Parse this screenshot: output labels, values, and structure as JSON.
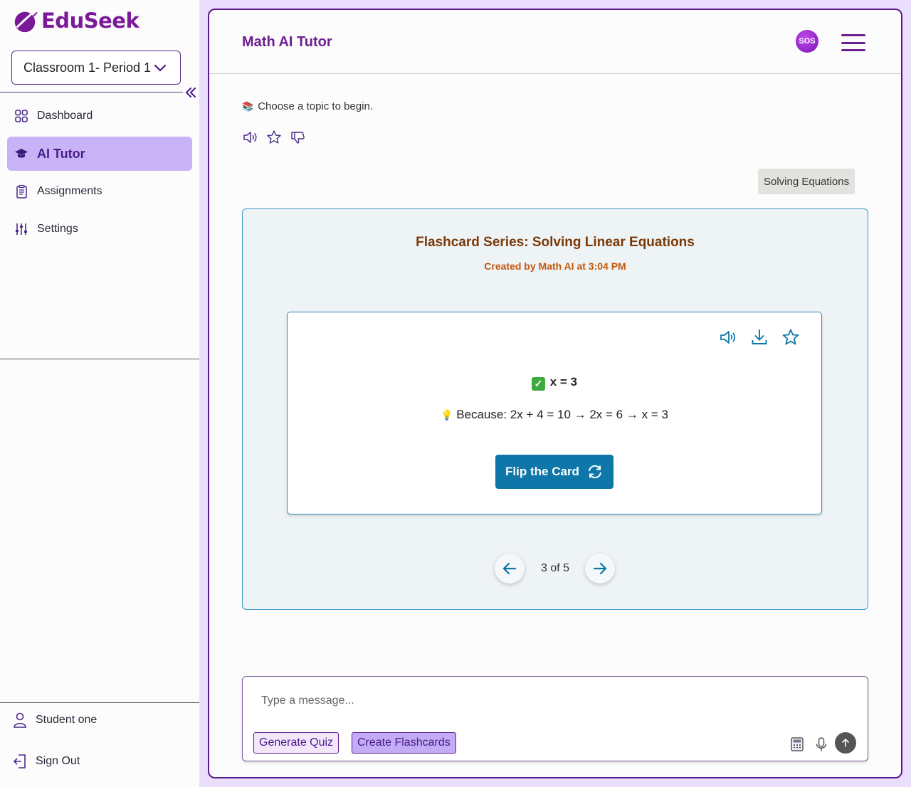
{
  "app": {
    "name": "EduSeek"
  },
  "sidebar": {
    "classroom_select": "Classroom 1- Period 1",
    "nav": [
      {
        "label": "Dashboard",
        "icon": "grid-icon"
      },
      {
        "label": "AI Tutor",
        "icon": "graduation-cap-icon",
        "active": true
      },
      {
        "label": "Assignments",
        "icon": "clipboard-icon"
      },
      {
        "label": "Settings",
        "icon": "sliders-icon"
      }
    ],
    "user_label": "Student one",
    "signout_label": "Sign Out"
  },
  "header": {
    "title": "Math AI Tutor",
    "sos_label": "SOS"
  },
  "chat": {
    "bot_message": "Choose a topic to begin.",
    "user_message": "Solving Equations"
  },
  "flashcards": {
    "title": "Flashcard Series: Solving Linear Equations",
    "subtitle": "Created by Math AI at 3:04 PM",
    "answer": "x = 3",
    "reason": "Because: 2x + 4 = 10 → 2x = 6 → x = 3",
    "flip_label": "Flip the Card",
    "page_indicator": "3 of 5",
    "current_page": 3,
    "total_pages": 5
  },
  "composer": {
    "placeholder": "Type a message...",
    "chip_quiz": "Generate Quiz",
    "chip_flashcards": "Create Flashcards"
  },
  "colors": {
    "brand": "#7a1a9a",
    "accent": "#0e76a8",
    "active_nav": "#c7b3f5"
  }
}
